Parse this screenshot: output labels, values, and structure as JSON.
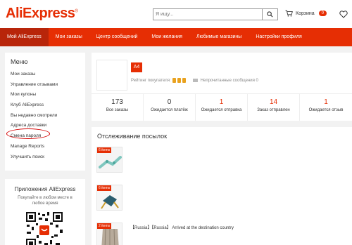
{
  "header": {
    "logo": "AliExpress",
    "logo_mark": "®",
    "search_placeholder": "Я ищу...",
    "cart_label": "Корзина",
    "cart_count": "0"
  },
  "nav": {
    "items": [
      "Мой AliExpress",
      "Мои заказы",
      "Центр сообщений",
      "Мои желания",
      "Любимые магазины",
      "Настройки профиля"
    ]
  },
  "sidebar": {
    "title": "Меню",
    "items": [
      "Мои заказы",
      "Управление отзывами",
      "Мои купоны",
      "Клуб AliExpress",
      "Вы недавно смотрели",
      "Адреса доставки",
      "Смена пароля",
      "Manage Reports",
      "Улучшить поиск"
    ]
  },
  "app_box": {
    "title": "Приложения AliExpress",
    "subtitle": "Покупайте в любом месте в любое время"
  },
  "profile": {
    "level": "A4",
    "rating_label": "Рейтинг покупателя:",
    "messages_label": "Непрочитанные сообщения 0",
    "stats": [
      {
        "value": "173",
        "label": "Все заказы",
        "highlight": false
      },
      {
        "value": "0",
        "label": "Ожидается платёж",
        "highlight": false
      },
      {
        "value": "1",
        "label": "Ожидается отправка",
        "highlight": true
      },
      {
        "value": "14",
        "label": "Заказ отправлен",
        "highlight": true
      },
      {
        "value": "1",
        "label": "Ожидается отзыв",
        "highlight": true
      }
    ]
  },
  "tracking": {
    "title": "Отслеживание посылок",
    "parcels": [
      {
        "tag": "6 items"
      },
      {
        "tag": "6 items"
      },
      {
        "tag": "2 items"
      }
    ],
    "status_text": "【Russia】【Russia】 Arrived at the destination country"
  },
  "colors": {
    "accent": "#e62e04",
    "nav_active": "#b8250a",
    "background": "#f2f2f2"
  }
}
